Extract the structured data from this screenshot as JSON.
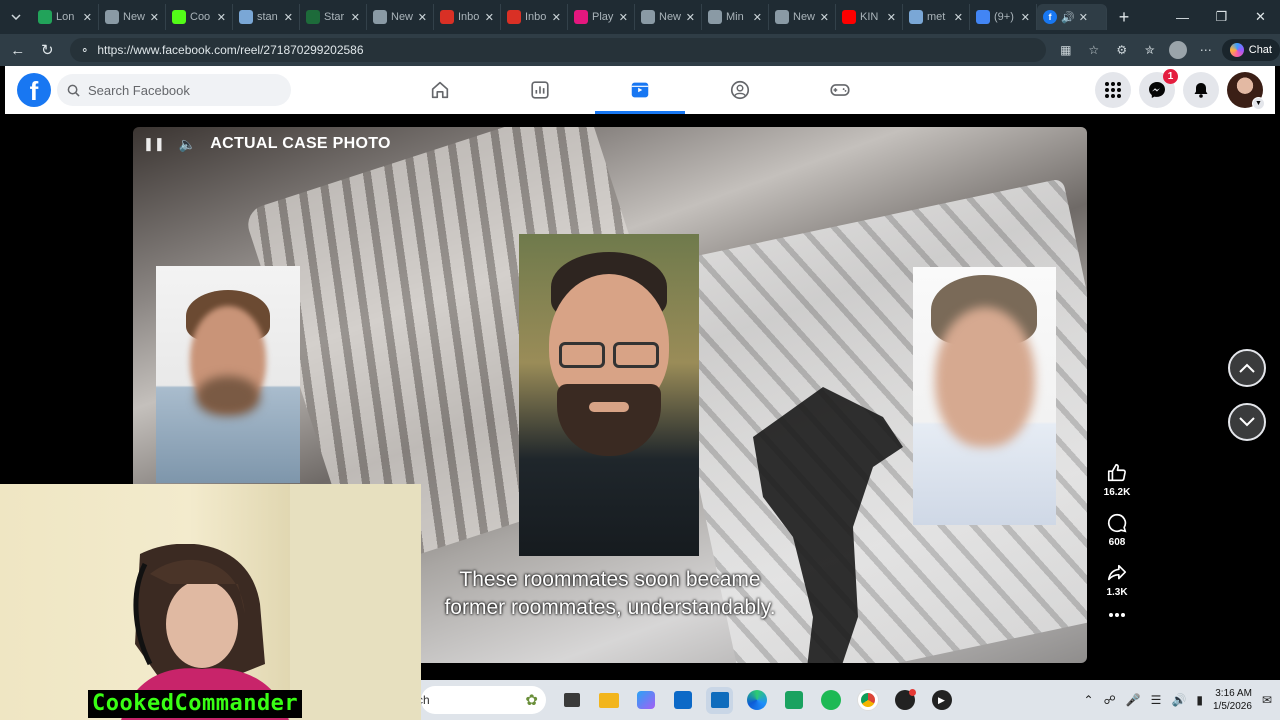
{
  "browser": {
    "tabs": [
      {
        "label": "Lon",
        "favicon": "s-green",
        "color": "#22a35a"
      },
      {
        "label": "New",
        "favicon": "page",
        "color": "#8a9aa5"
      },
      {
        "label": "Coo",
        "favicon": "k-green",
        "color": "#53fc18"
      },
      {
        "label": "stan",
        "favicon": "search",
        "color": "#7aa7d6"
      },
      {
        "label": "Star",
        "favicon": "s-dark",
        "color": "#1d6b3a"
      },
      {
        "label": "New",
        "favicon": "page",
        "color": "#8a9aa5"
      },
      {
        "label": "Inbo",
        "favicon": "gmail",
        "color": "#d93025"
      },
      {
        "label": "Inbo",
        "favicon": "gmail",
        "color": "#d93025"
      },
      {
        "label": "Play",
        "favicon": "plz",
        "color": "#e5177e"
      },
      {
        "label": "New",
        "favicon": "page",
        "color": "#8a9aa5"
      },
      {
        "label": "Min",
        "favicon": "s-outline",
        "color": "#8a9aa5"
      },
      {
        "label": "New",
        "favicon": "page",
        "color": "#8a9aa5"
      },
      {
        "label": "KIN",
        "favicon": "youtube",
        "color": "#ff0000"
      },
      {
        "label": "met",
        "favicon": "search",
        "color": "#7aa7d6"
      },
      {
        "label": "(9+)",
        "favicon": "google",
        "color": "#4285f4"
      }
    ],
    "active_tab_favicon": "facebook",
    "new_tab_label": "+",
    "url": "https://www.facebook.com/reel/271870299202586",
    "chat_label": "Chat"
  },
  "facebook": {
    "search_placeholder": "Search Facebook",
    "nav_items": [
      "home",
      "dashboard",
      "reels",
      "groups",
      "gaming"
    ],
    "active_nav": "reels",
    "messenger_badge": "1",
    "brand_color": "#1877f2"
  },
  "reel": {
    "overlay_title": "ACTUAL CASE PHOTO",
    "caption_line1": "These roommates soon became",
    "caption_line2": "former roommates, understandably.",
    "likes": "16.2K",
    "comments": "608",
    "shares": "1.3K"
  },
  "stream": {
    "streamer_name": "CookedCommander"
  },
  "taskbar": {
    "search_text": "ch",
    "time": "3:16 AM",
    "date": "1/5/2026"
  }
}
